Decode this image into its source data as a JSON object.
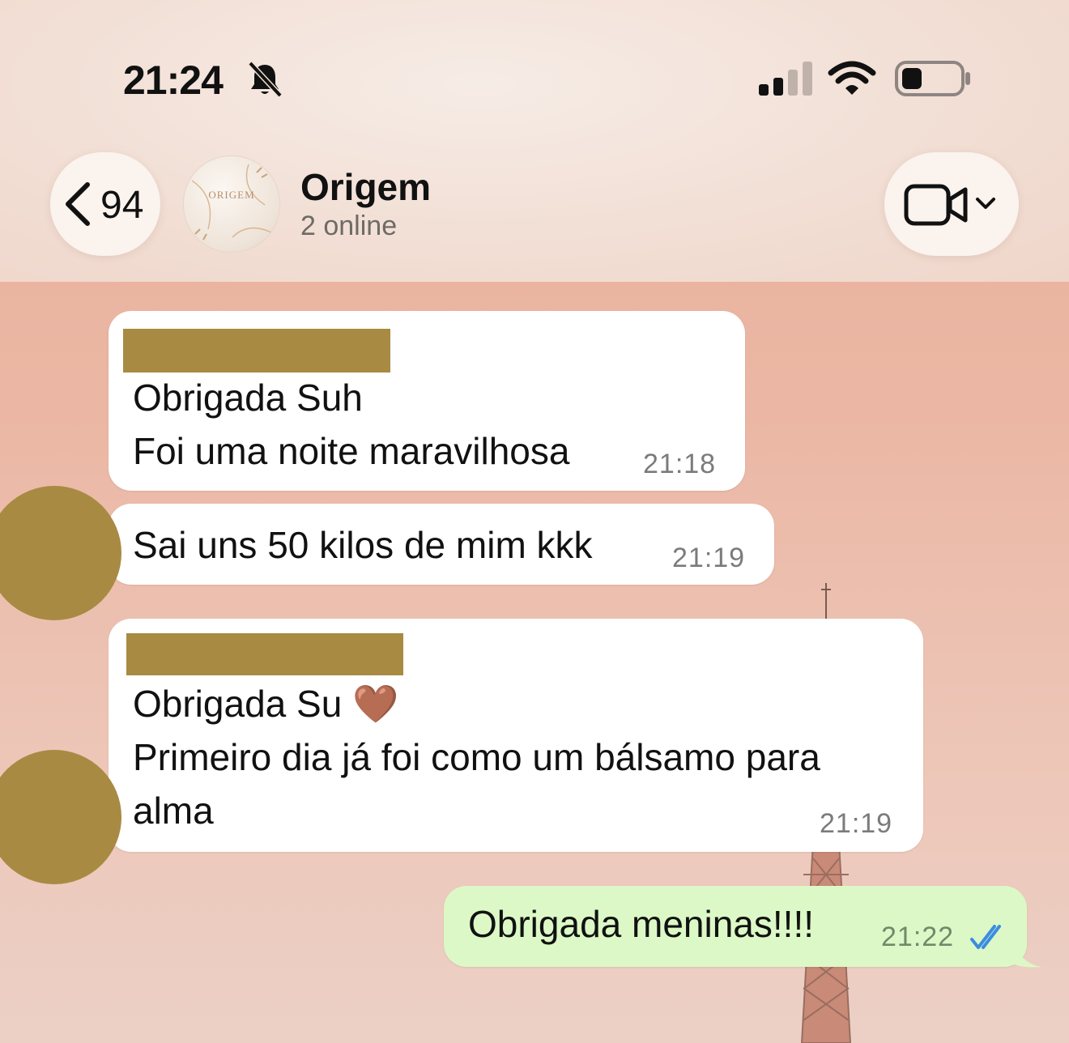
{
  "status_bar": {
    "time": "21:24",
    "icons": [
      "bell-slash-icon",
      "cellular-signal-icon",
      "wifi-icon",
      "battery-icon"
    ]
  },
  "header": {
    "back_count": "94",
    "chat_title": "Origem",
    "subtitle": "2 online",
    "avatar_text": "ORIGEM"
  },
  "messages": [
    {
      "lines": [
        "Obrigada Suh",
        "Foi uma noite maravilhosa"
      ],
      "time": "21:18"
    },
    {
      "lines": [
        "Sai uns 50 kilos de mim kkk"
      ],
      "time": "21:19"
    },
    {
      "lines": [
        "Obrigada Su 🤎",
        "Primeiro dia já foi como um bálsamo para",
        "alma"
      ],
      "time": "21:19"
    },
    {
      "lines": [
        "Obrigada meninas!!!!"
      ],
      "time": "21:22"
    }
  ],
  "colors": {
    "incoming_bubble": "#ffffff",
    "outgoing_bubble": "#dcf8c6",
    "redaction": "#a88a42",
    "read_ticks": "#3b8de0"
  }
}
